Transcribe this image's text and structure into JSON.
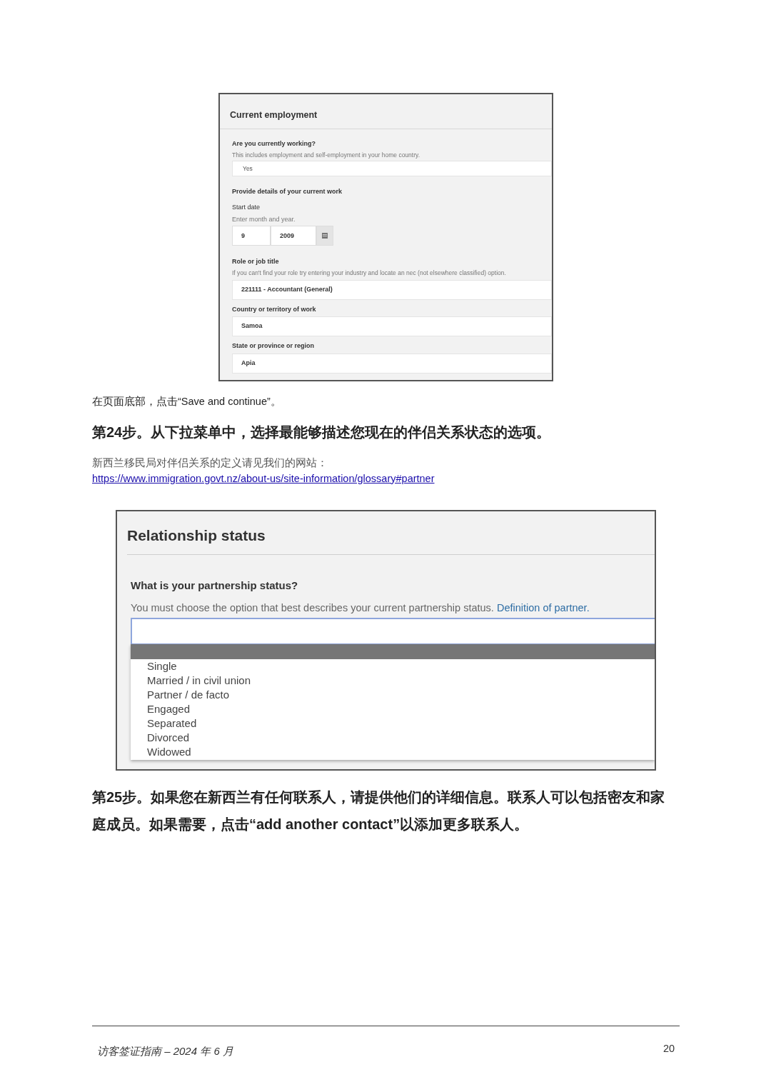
{
  "employment_screenshot": {
    "title": "Current employment",
    "fields": [
      {
        "kind": "select",
        "label": "Are you currently working?",
        "hint": "This includes employment and self-employment in your home country.",
        "value": "Yes"
      },
      {
        "kind": "heading",
        "label": "Provide details of your current work"
      },
      {
        "kind": "date",
        "label": "Start date",
        "hint": "Enter month and year.",
        "month": "9",
        "year": "2009"
      },
      {
        "kind": "select",
        "label": "Role or job title",
        "hint": "If you can't find your role try entering your industry and locate an nec (not elsewhere classified) option.",
        "value": "221111 - Accountant (General)"
      },
      {
        "kind": "select",
        "label": "Country or territory of work",
        "value": "Samoa"
      },
      {
        "kind": "select",
        "label": "State or province or region",
        "value": "Apia"
      }
    ]
  },
  "instruction": "在页面底部，点击“Save and continue”。",
  "step_24": "第24步。从下拉菜单中，选择最能够描述您现在的伴侣关系状态的选项。",
  "note": "新西兰移民局对伴侣关系的定义请见我们的网站：",
  "link": "https://www.immigration.govt.nz/about-us/site-information/glossary#partner",
  "relationship_screenshot": {
    "title": "Relationship status",
    "question": "What is your partnership status?",
    "hint": "You must choose the option that best describes your current partnership status.",
    "hint_link": "Definition of partner.",
    "blank_option_highlighted": true,
    "options": [
      "Single",
      "Married / in civil union",
      "Partner / de facto",
      "Engaged",
      "Separated",
      "Divorced",
      "Widowed"
    ]
  },
  "step_25": "第25步。如果您在新西兰有任何联系人，请提供他们的详细信息。联系人可以包括密友和家庭成员。如果需要，点击“add another contact”以添加更多联系人。",
  "footer": {
    "title": "访客签证指南 – 2024 年 6 月",
    "page": "20"
  }
}
